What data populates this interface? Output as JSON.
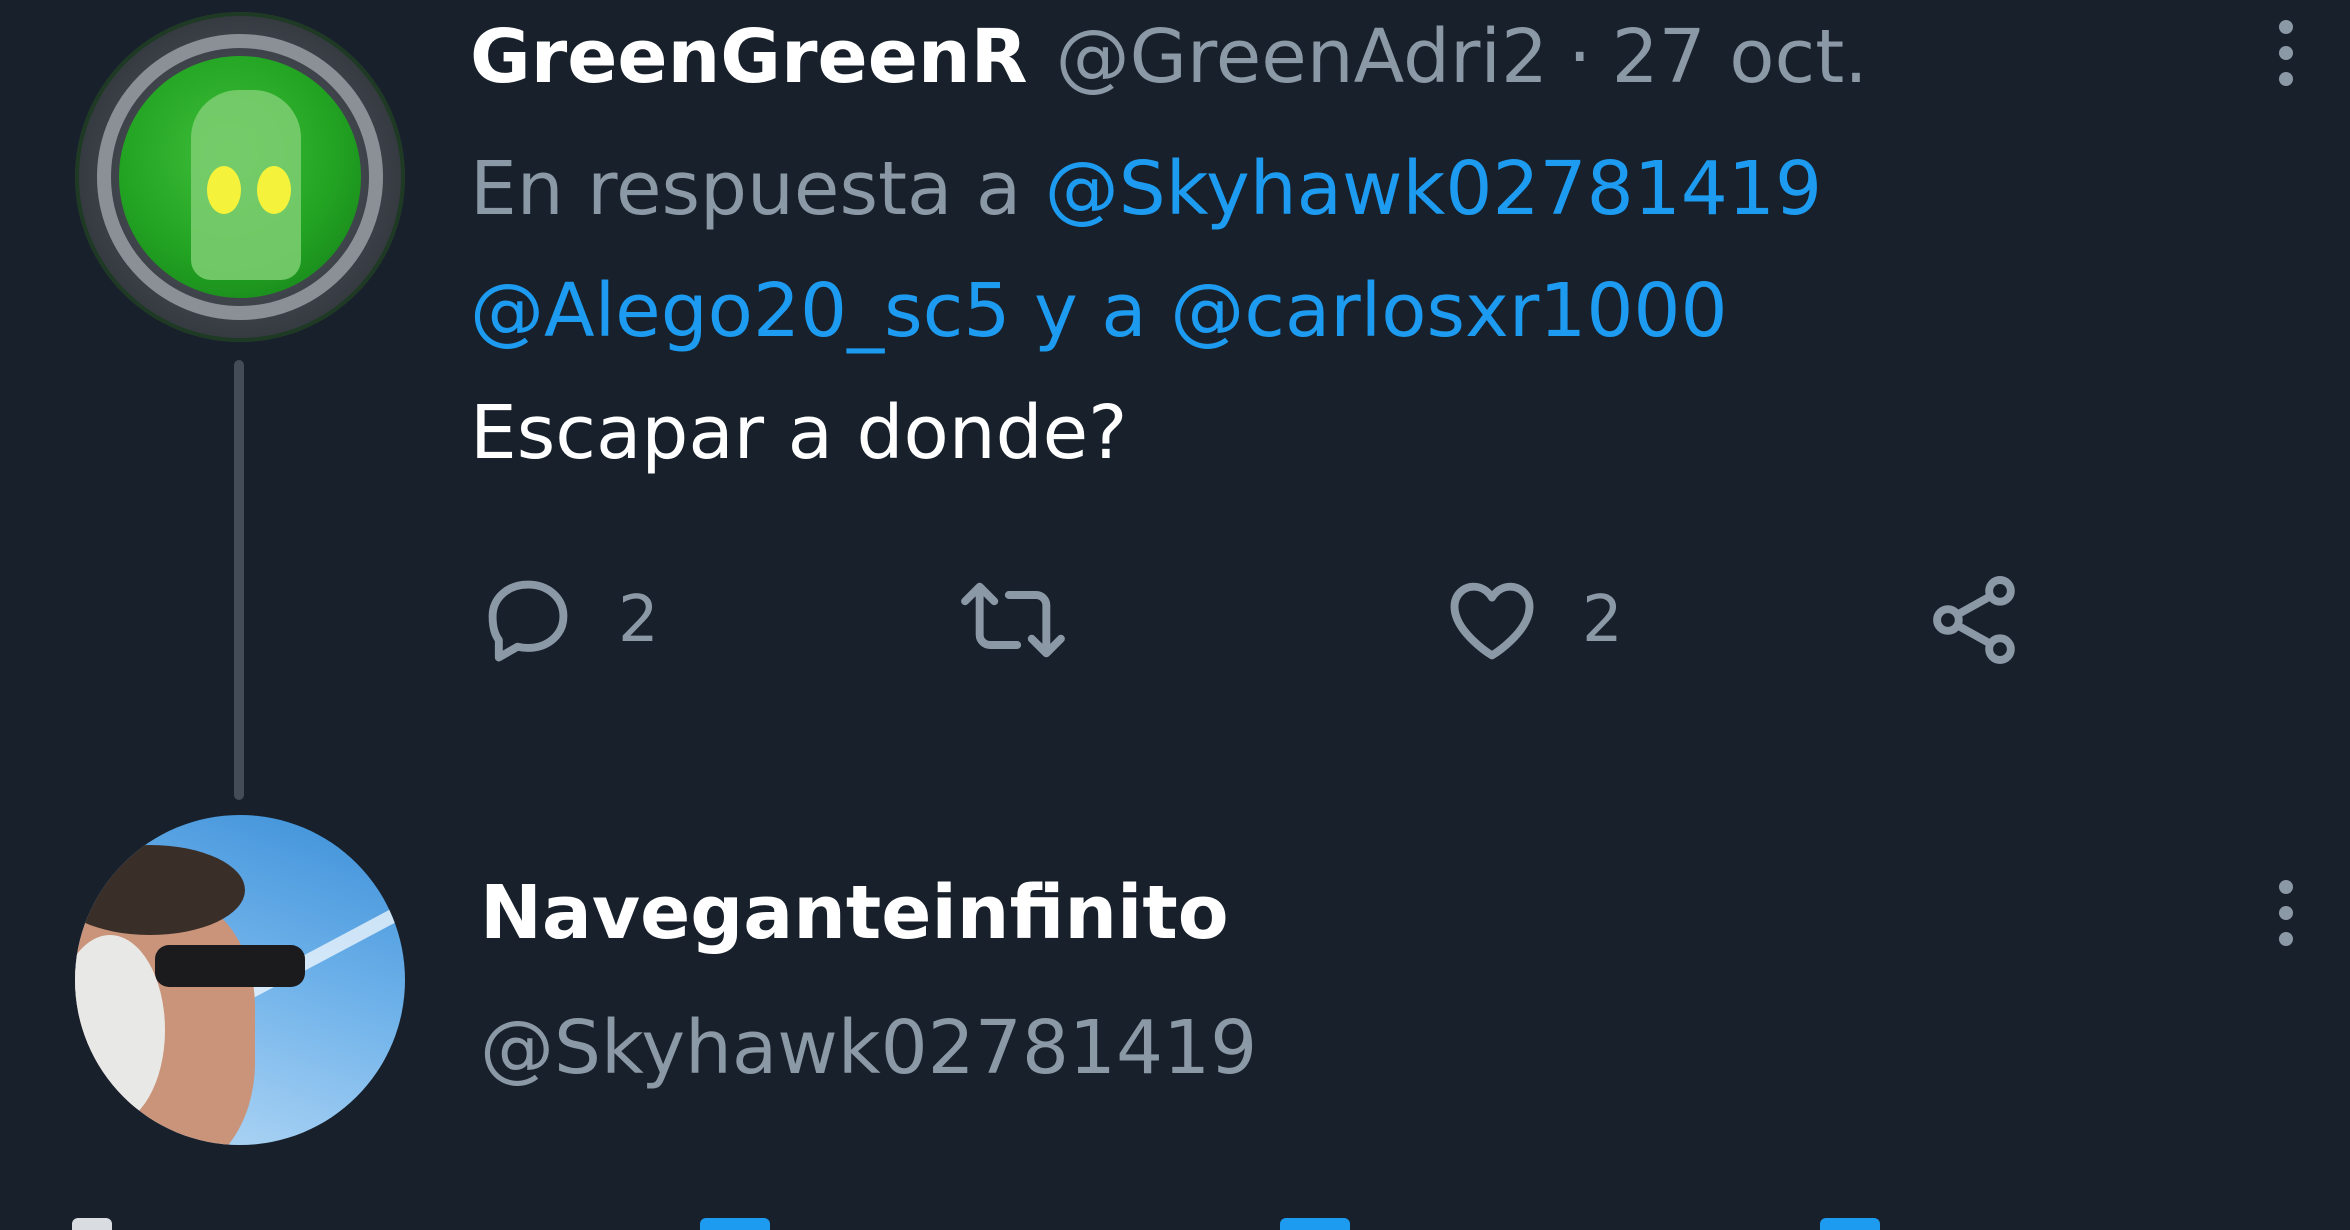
{
  "tweet1": {
    "display_name": "GreenGreenR",
    "handle": "@GreenAdri2",
    "separator": "·",
    "date": "27 oct.",
    "replying_prefix": "En respuesta a",
    "mention1": "@Skyhawk02781419",
    "mention2": "@Alego20_sc5",
    "conjunction": "y a",
    "mention3": "@carlosxr1000",
    "text": "Escapar a donde?",
    "actions": {
      "reply_count": "2",
      "retweet_count": "",
      "like_count": "2"
    }
  },
  "tweet2": {
    "display_name": "Naveganteinfinito",
    "handle": "@Skyhawk02781419"
  },
  "icons": [
    "more-icon",
    "reply-icon",
    "retweet-icon",
    "like-icon",
    "share-icon"
  ],
  "colors": {
    "background": "#17202b",
    "primary_text": "#ffffff",
    "secondary_text": "#8b98a5",
    "link": "#1d9bf0",
    "thread_line": "#434c57"
  }
}
